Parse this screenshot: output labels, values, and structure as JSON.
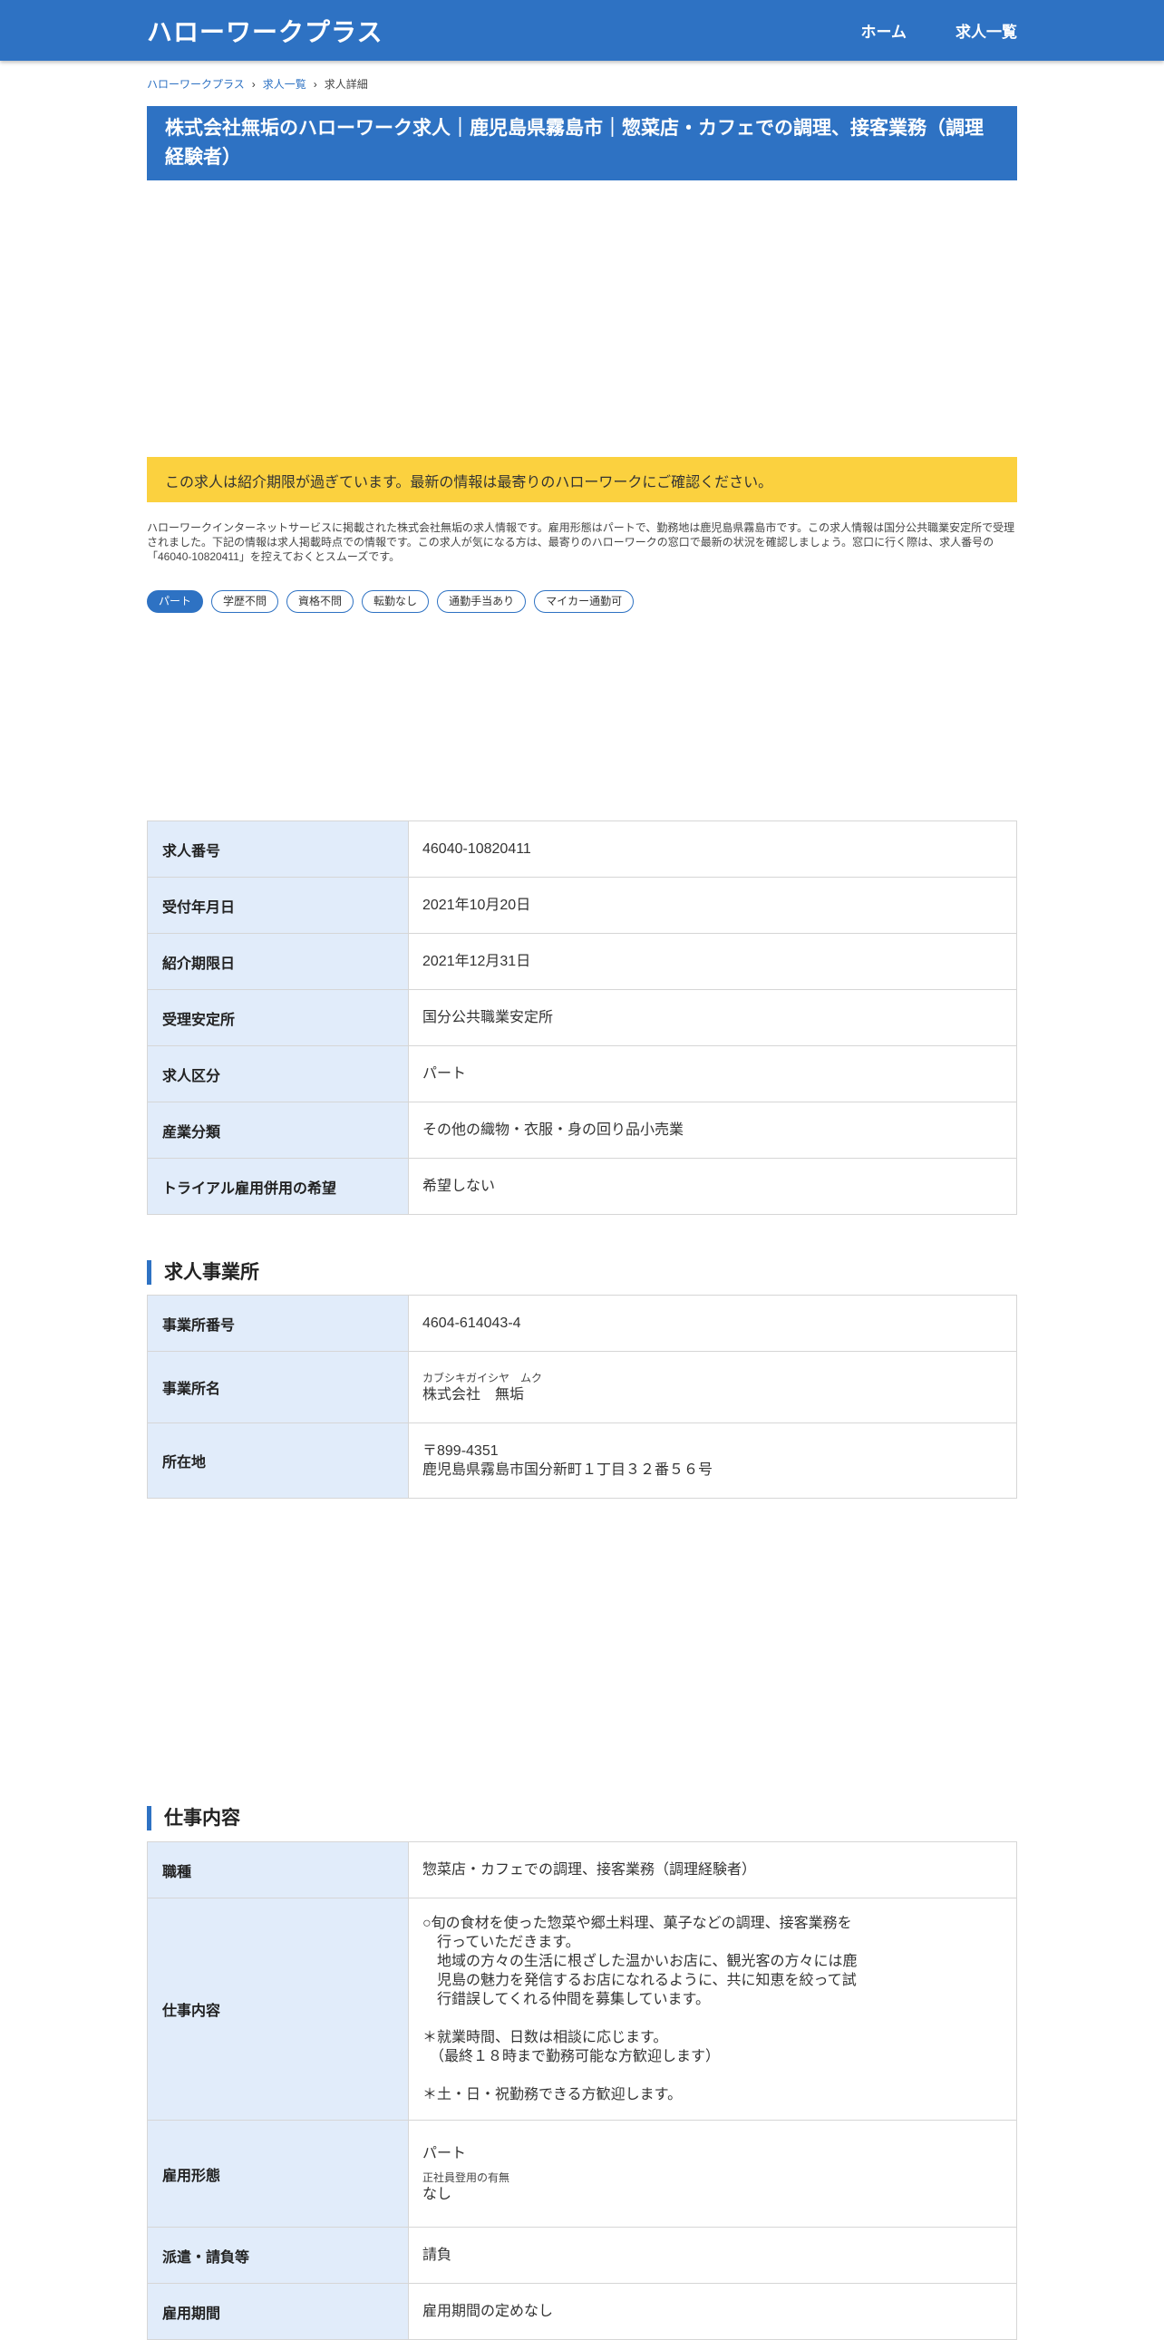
{
  "header": {
    "logo": "ハローワークプラス",
    "nav": [
      "ホーム",
      "求人一覧"
    ]
  },
  "breadcrumb": {
    "items": [
      "ハローワークプラス",
      "求人一覧",
      "求人詳細"
    ],
    "separator": "›"
  },
  "title": "株式会社無垢のハローワーク求人｜鹿児島県霧島市｜惣菜店・カフェでの調理、接客業務（調理経験者）",
  "notice": "この求人は紹介期限が過ぎています。最新の情報は最寄りのハローワークにご確認ください。",
  "intro": "ハローワークインターネットサービスに掲載された株式会社無垢の求人情報です。雇用形態はパートで、勤務地は鹿児島県霧島市です。この求人情報は国分公共職業安定所で受理されました。下記の情報は求人掲載時点での情報です。この求人が気になる方は、最寄りのハローワークの窓口で最新の状況を確認しましょう。窓口に行く際は、求人番号の「46040-10820411」を控えておくとスムーズです。",
  "tags": [
    "パート",
    "学歴不問",
    "資格不問",
    "転勤なし",
    "通勤手当あり",
    "マイカー通勤可"
  ],
  "basic": {
    "rows": [
      {
        "label": "求人番号",
        "value": "46040-10820411"
      },
      {
        "label": "受付年月日",
        "value": "2021年10月20日"
      },
      {
        "label": "紹介期限日",
        "value": "2021年12月31日"
      },
      {
        "label": "受理安定所",
        "value": "国分公共職業安定所"
      },
      {
        "label": "求人区分",
        "value": "パート"
      },
      {
        "label": "産業分類",
        "value": "その他の織物・衣服・身の回り品小売業"
      },
      {
        "label": "トライアル雇用併用の希望",
        "value": "希望しない"
      }
    ]
  },
  "office": {
    "heading": "求人事業所",
    "number_label": "事業所番号",
    "number": "4604-614043-4",
    "name_label": "事業所名",
    "name_kana": "カブシキガイシヤ　ムク",
    "name": "株式会社　無垢",
    "address_label": "所在地",
    "zip": "〒899-4351",
    "address": "鹿児島県霧島市国分新町１丁目３２番５６号"
  },
  "job": {
    "heading": "仕事内容",
    "type_label": "職種",
    "type": "惣菜店・カフェでの調理、接客業務（調理経験者）",
    "content_label": "仕事内容",
    "content": "○旬の食材を使った惣菜や郷土料理、菓子などの調理、接客業務を\n　行っていただきます。\n　地域の方々の生活に根ざした温かいお店に、観光客の方々には鹿\n　児島の魅力を発信するお店になれるように、共に知恵を絞って試\n　行錯誤してくれる仲間を募集しています。\n\n＊就業時間、日数は相談に応じます。\n　（最終１８時まで勤務可能な方歓迎します）\n\n＊土・日・祝勤務できる方歓迎します。",
    "employment_label": "雇用形態",
    "employment": "パート",
    "regular_label": "正社員登用の有無",
    "regular": "なし",
    "dispatch_label": "派遣・請負等",
    "dispatch": "請負",
    "period_label": "雇用期間",
    "period": "雇用期間の定めなし"
  }
}
